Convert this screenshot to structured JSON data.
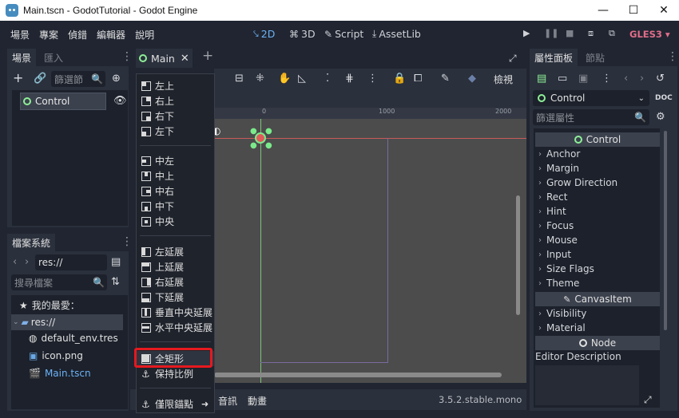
{
  "window": {
    "title": "Main.tscn - GodotTutorial - Godot Engine",
    "minimize": "—",
    "maximize": "☐",
    "close": "✕"
  },
  "menubar": {
    "items": [
      "場景",
      "專案",
      "偵錯",
      "編輯器",
      "說明"
    ],
    "workspaces": [
      {
        "label": "2D",
        "glyph": "⤥",
        "active": true
      },
      {
        "label": "3D",
        "glyph": "⌘",
        "active": false
      },
      {
        "label": "Script",
        "glyph": "✎",
        "active": false
      },
      {
        "label": "AssetLib",
        "glyph": "⤓",
        "active": false
      }
    ],
    "renderer": "GLES3 ▾"
  },
  "scene_dock": {
    "tabs": [
      "場景",
      "匯入"
    ],
    "filter_placeholder": "篩選節",
    "root_node": "Control"
  },
  "filesystem_dock": {
    "tab": "檔案系統",
    "path": "res://",
    "search_placeholder": "搜尋檔案",
    "favorites_label": "我的最愛：",
    "root": "res://",
    "files": [
      "default_env.tres",
      "icon.png",
      "Main.tscn"
    ]
  },
  "viewport": {
    "tab": "Main",
    "view_button": "檢視",
    "ruler_marks": [
      "0",
      "1000",
      "2000"
    ],
    "bottom_tabs": [
      "音訊",
      "動畫"
    ],
    "version": "3.5.2.stable.mono"
  },
  "layout_menu": {
    "groups": [
      [
        {
          "label": "左上",
          "icon": "anchor-top-left"
        },
        {
          "label": "右上",
          "icon": "anchor-top-right"
        },
        {
          "label": "右下",
          "icon": "anchor-bottom-right"
        },
        {
          "label": "左下",
          "icon": "anchor-bottom-left"
        }
      ],
      [
        {
          "label": "中左",
          "icon": "anchor-center-left"
        },
        {
          "label": "中上",
          "icon": "anchor-center-top"
        },
        {
          "label": "中右",
          "icon": "anchor-center-right"
        },
        {
          "label": "中下",
          "icon": "anchor-center-bottom"
        },
        {
          "label": "中央",
          "icon": "anchor-center"
        }
      ],
      [
        {
          "label": "左延展",
          "icon": "wide-left"
        },
        {
          "label": "上延展",
          "icon": "wide-top"
        },
        {
          "label": "右延展",
          "icon": "wide-right"
        },
        {
          "label": "下延展",
          "icon": "wide-bottom"
        },
        {
          "label": "垂直中央延展",
          "icon": "vcenter-wide"
        },
        {
          "label": "水平中央延展",
          "icon": "hcenter-wide"
        }
      ],
      [
        {
          "label": "全矩形",
          "icon": "full-rect"
        },
        {
          "label": "保持比例",
          "icon": "anchor-keep-ratio"
        }
      ],
      [
        {
          "label": "僅限錨點",
          "icon": "anchor-only"
        }
      ]
    ],
    "highlighted": "全矩形"
  },
  "inspector": {
    "tabs": [
      "屬性面板",
      "節點"
    ],
    "node_selector": "Control",
    "filter_placeholder": "篩選屬性",
    "sections": [
      {
        "header": "Control",
        "props": [
          "Anchor",
          "Margin",
          "Grow Direction",
          "Rect",
          "Hint",
          "Focus",
          "Mouse",
          "Input",
          "Size Flags",
          "Theme"
        ]
      },
      {
        "header": "CanvasItem",
        "props": [
          "Visibility",
          "Material"
        ]
      },
      {
        "header": "Node",
        "props": []
      }
    ],
    "editor_description": "Editor Description"
  }
}
